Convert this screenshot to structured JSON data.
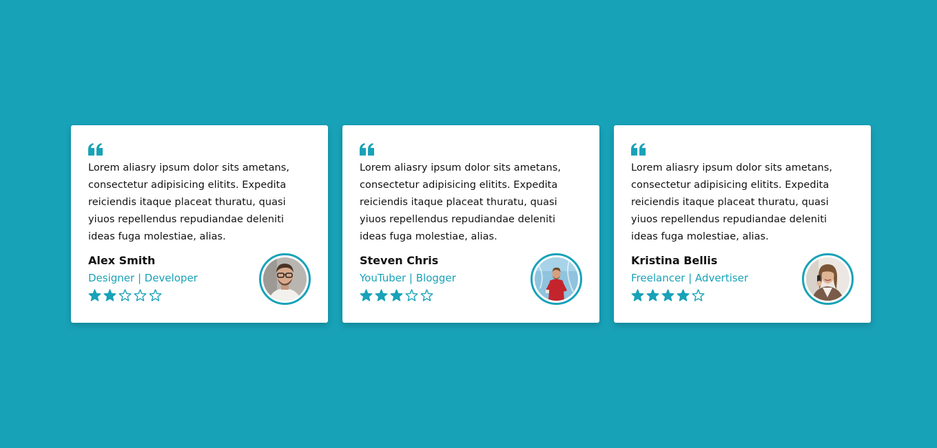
{
  "colors": {
    "background": "#18a2b8",
    "accent": "#18a2b8",
    "card": "#ffffff",
    "text": "#111111"
  },
  "cards": [
    {
      "quote_icon": "quote-left-icon",
      "review": "Lorem aliasry ipsum dolor sits ametans, consectetur adipisicing elitits. Expedita reiciendis itaque placeat thuratu, quasi yiuos repellendus repudiandae deleniti ideas fuga molestiae, alias.",
      "name": "Alex Smith",
      "role": "Designer | Developer",
      "rating": 2,
      "max_rating": 5,
      "avatar": "avatar-man-glasses"
    },
    {
      "quote_icon": "quote-left-icon",
      "review": "Lorem aliasry ipsum dolor sits ametans, consectetur adipisicing elitits. Expedita reiciendis itaque placeat thuratu, quasi yiuos repellendus repudiandae deleniti ideas fuga molestiae, alias.",
      "name": "Steven Chris",
      "role": "YouTuber | Blogger",
      "rating": 3,
      "max_rating": 5,
      "avatar": "avatar-man-red-sweater"
    },
    {
      "quote_icon": "quote-left-icon",
      "review": "Lorem aliasry ipsum dolor sits ametans, consectetur adipisicing elitits. Expedita reiciendis itaque placeat thuratu, quasi yiuos repellendus repudiandae deleniti ideas fuga molestiae, alias.",
      "name": "Kristina Bellis",
      "role": "Freelancer | Advertiser",
      "rating": 4,
      "max_rating": 5,
      "avatar": "avatar-woman-phone"
    }
  ]
}
